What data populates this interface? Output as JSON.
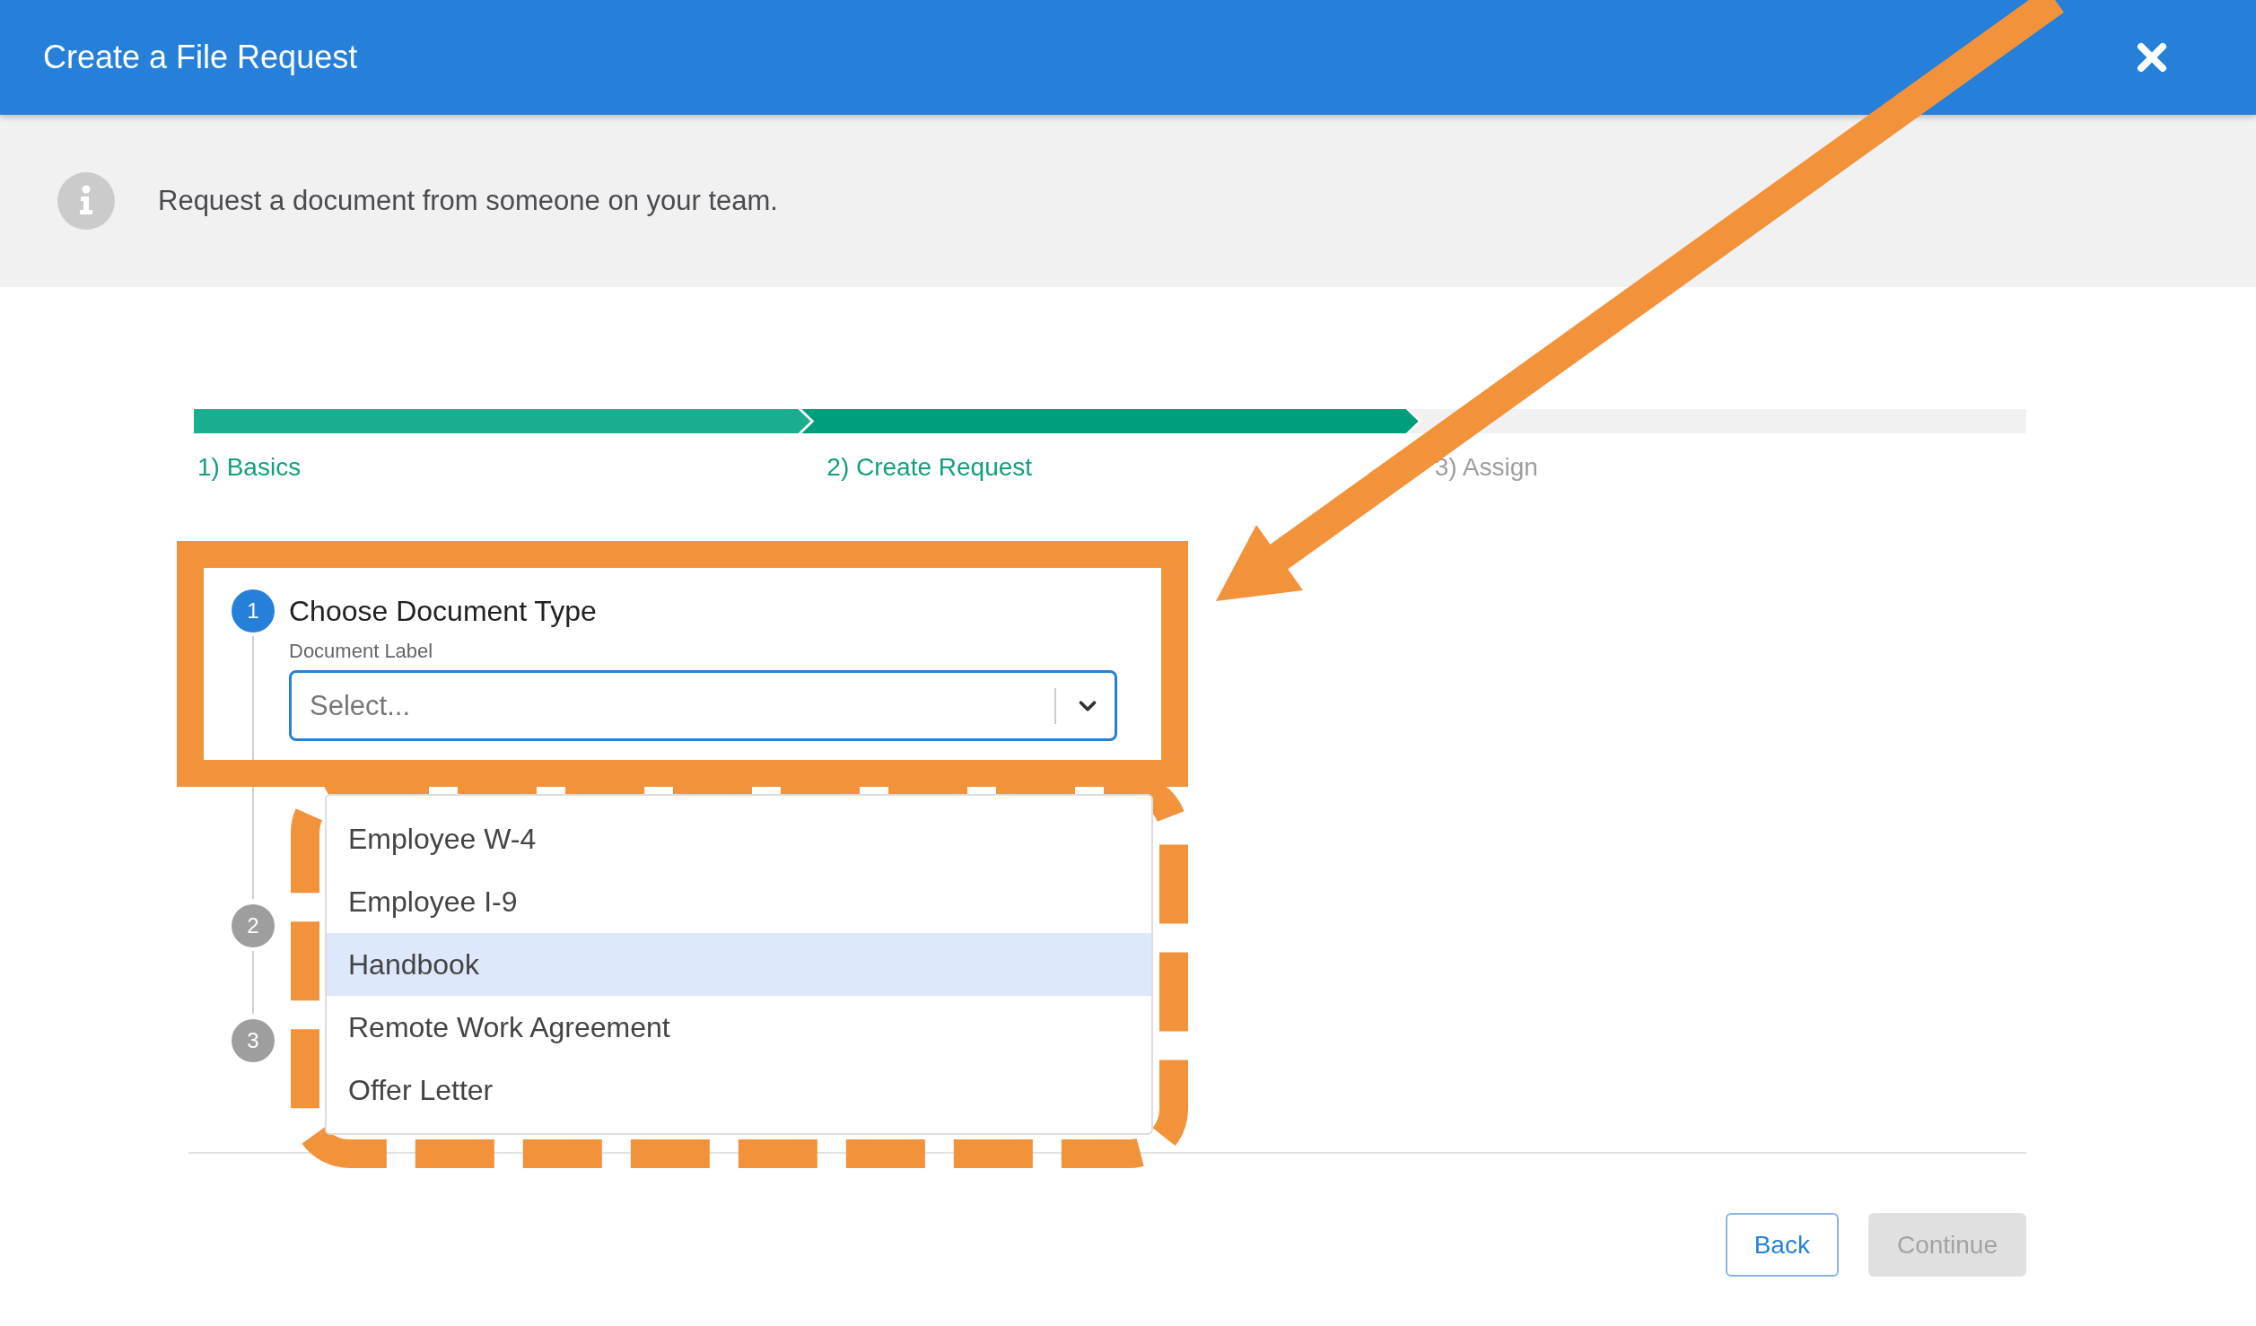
{
  "header": {
    "title": "Create a File Request"
  },
  "info": {
    "message": "Request a document from someone on your team."
  },
  "progress": {
    "steps": [
      {
        "label": "1) Basics",
        "done": true,
        "selected": false
      },
      {
        "label": "2) Create Request",
        "done": false,
        "selected": true
      },
      {
        "label": "3) Assign",
        "done": false,
        "selected": false
      }
    ]
  },
  "form": {
    "steps": [
      {
        "number": "1",
        "title": "Choose Document Type",
        "active": true
      },
      {
        "number": "2",
        "active": false
      },
      {
        "number": "3",
        "active": false
      }
    ],
    "field": {
      "label": "Document Label",
      "placeholder": "Select..."
    },
    "options": [
      {
        "label": "Employee W-4",
        "selected": false
      },
      {
        "label": "Employee I-9",
        "selected": false
      },
      {
        "label": "Handbook",
        "selected": true
      },
      {
        "label": "Remote Work Agreement",
        "selected": false
      },
      {
        "label": "Offer Letter",
        "selected": false
      }
    ]
  },
  "buttons": [
    {
      "label": "Back",
      "disabled": false
    },
    {
      "label": "Continue",
      "disabled": true
    }
  ]
}
